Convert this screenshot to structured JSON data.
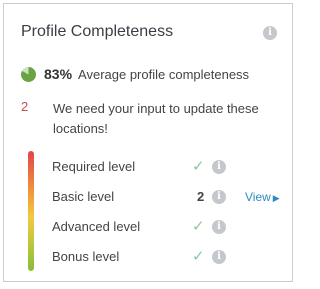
{
  "card": {
    "title": "Profile Completeness",
    "info_icon": "info-icon"
  },
  "summary": {
    "percent": "83%",
    "text": "Average profile completeness",
    "pie_value": 0.83,
    "icon": "pie-chart-icon"
  },
  "alert": {
    "count": "2",
    "text": "We need your input to update these locations!"
  },
  "levels": [
    {
      "label": "Required level",
      "status_icon": "check-icon",
      "info_icon": "info-icon"
    },
    {
      "label": "Basic level",
      "count": "2",
      "info_icon": "info-icon",
      "link": "View"
    },
    {
      "label": "Advanced level",
      "status_icon": "check-icon",
      "info_icon": "info-icon"
    },
    {
      "label": "Bonus level",
      "status_icon": "check-icon",
      "info_icon": "info-icon"
    }
  ],
  "colors": {
    "accent_link": "#2e8bc0",
    "alert": "#c24d56",
    "check": "#8fc79a",
    "pie": "#6aa341",
    "gradient": [
      "#e0444c",
      "#ef8d3c",
      "#f2c93e",
      "#c2c83c",
      "#86bd3a"
    ]
  }
}
